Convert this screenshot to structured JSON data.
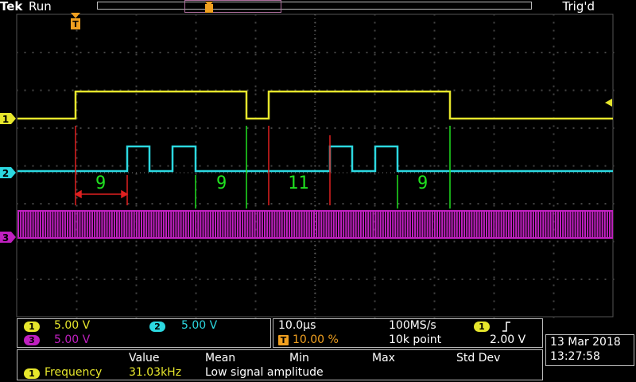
{
  "header": {
    "brand": "Tek",
    "state": "Run",
    "trigger_status": "Trig'd"
  },
  "markers": {
    "trigger_position": "T",
    "ch1": "1",
    "ch2": "2",
    "ch3": "3"
  },
  "annotations": [
    {
      "text": "9",
      "color": "#20e020"
    },
    {
      "text": "9",
      "color": "#20e020"
    },
    {
      "text": "11",
      "color": "#20e020"
    },
    {
      "text": "9",
      "color": "#20e020"
    }
  ],
  "channels": {
    "ch1": {
      "id": "1",
      "scale": "5.00 V",
      "color": "#e6e62c"
    },
    "ch2": {
      "id": "2",
      "scale": "5.00 V",
      "color": "#2cd8e0"
    },
    "ch3": {
      "id": "3",
      "scale": "5.00 V",
      "color": "#c020c0"
    }
  },
  "timebase": {
    "time_per_div": "10.0µs",
    "sample_rate": "100MS/s",
    "trigger_pos": "10.00 %",
    "record_length": "10k point",
    "trigger_channel": "1",
    "trigger_slope_icon": "rising-edge-icon",
    "trigger_level": "2.00 V"
  },
  "datetime": {
    "date": "13 Mar 2018",
    "time": "13:27:58"
  },
  "measurements": {
    "headers": [
      "Value",
      "Mean",
      "Min",
      "Max",
      "Std Dev"
    ],
    "rows": [
      {
        "channel": "1",
        "name": "Frequency",
        "value": "31.03kHz",
        "note": "Low signal amplitude"
      }
    ]
  }
}
